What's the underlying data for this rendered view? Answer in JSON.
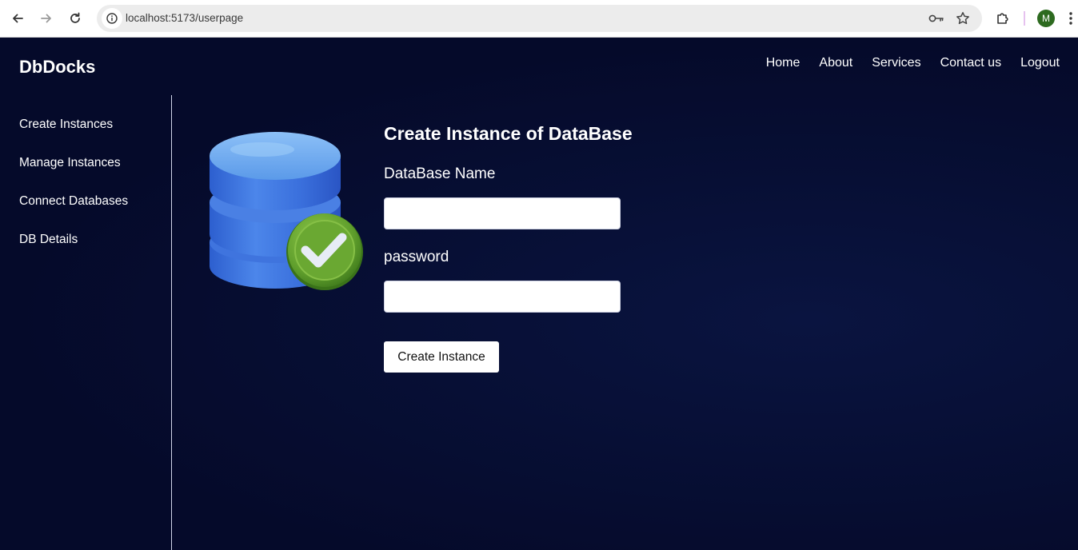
{
  "browser": {
    "url": "localhost:5173/userpage",
    "profile_initial": "M"
  },
  "header": {
    "brand": "DbDocks",
    "nav": [
      {
        "label": "Home"
      },
      {
        "label": "About"
      },
      {
        "label": "Services"
      },
      {
        "label": "Contact us"
      },
      {
        "label": "Logout"
      }
    ]
  },
  "sidebar": {
    "items": [
      {
        "label": "Create Instances"
      },
      {
        "label": "Manage Instances"
      },
      {
        "label": "Connect Databases"
      },
      {
        "label": "DB Details"
      }
    ]
  },
  "form": {
    "title": "Create Instance of DataBase",
    "db_name_label": "DataBase Name",
    "db_name_value": "",
    "password_label": "password",
    "password_value": "",
    "submit_label": "Create Instance"
  },
  "colors": {
    "page_background": "#050a2a",
    "database_blue": "#3f7be0",
    "check_green": "#6aa832"
  },
  "icons": {
    "back": "arrow-left-icon",
    "forward": "arrow-right-icon",
    "reload": "reload-icon",
    "site_info": "info-icon",
    "password_manager": "key-icon",
    "bookmark": "star-icon",
    "extensions": "puzzle-icon",
    "menu": "kebab-menu-icon",
    "illustration": "database-check-icon"
  }
}
